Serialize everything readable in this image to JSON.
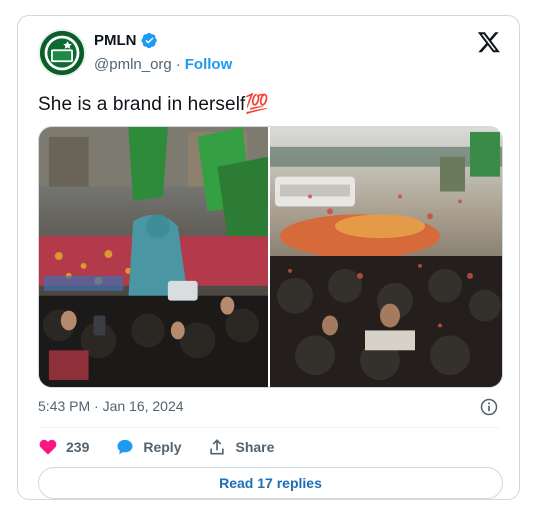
{
  "author": {
    "display_name": "PMLN",
    "handle": "@pmln_org",
    "separator": "·",
    "follow_label": "Follow",
    "avatar_label": "PML-N"
  },
  "tweet": {
    "text": "She is a brand in herself💯",
    "timestamp": "5:43 PM · Jan 16, 2024"
  },
  "actions": {
    "like_count": "239",
    "reply_label": "Reply",
    "share_label": "Share"
  },
  "footer": {
    "read_replies_label": "Read 17 replies"
  },
  "colors": {
    "accent": "#1d9bf0",
    "like": "#f91880",
    "link": "#1d6fb8",
    "text_secondary": "#536471",
    "border": "#cfd9de"
  },
  "icons": {
    "logo": "x-logo-icon",
    "verified": "verified-badge-icon",
    "info": "info-icon",
    "like": "heart-icon",
    "reply": "reply-bubble-icon",
    "share": "share-upload-icon"
  }
}
